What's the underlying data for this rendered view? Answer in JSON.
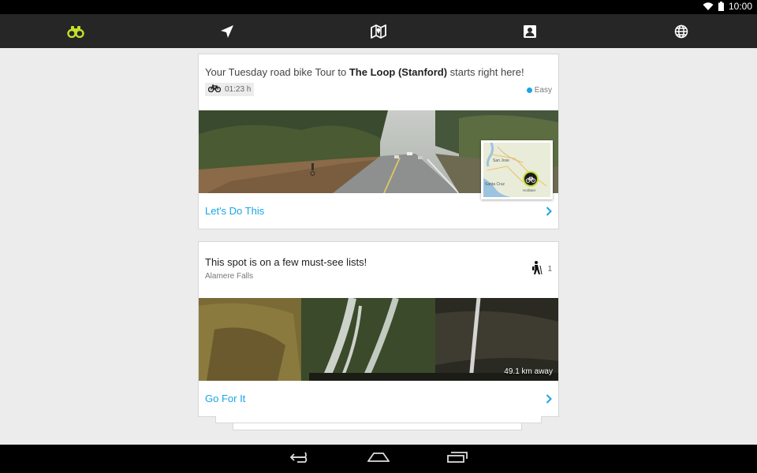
{
  "status_bar": {
    "time": "10:00"
  },
  "nav": {
    "tabs": [
      {
        "name": "discover",
        "icon": "binoculars-icon",
        "active": true
      },
      {
        "name": "navigate",
        "icon": "navigation-arrow-icon",
        "active": false
      },
      {
        "name": "map",
        "icon": "map-icon",
        "active": false
      },
      {
        "name": "profile",
        "icon": "contact-card-icon",
        "active": false
      },
      {
        "name": "explore",
        "icon": "globe-icon",
        "active": false
      }
    ],
    "active_color": "#c6e02c"
  },
  "cards": [
    {
      "intro": "Your Tuesday road bike Tour to ",
      "destination": "The Loop (Stanford)",
      "outro": " starts right here!",
      "duration": "01:23 h",
      "difficulty": "Easy",
      "difficulty_color": "#1aa4e6",
      "action": "Let's Do This",
      "map_labels": [
        "San Jose",
        "Santa Cruz",
        "Hollister"
      ]
    },
    {
      "title": "This spot is on a few must-see lists!",
      "subtitle": "Alamere Falls",
      "list_count": "1",
      "distance": "49.1 km away",
      "action": "Go For It"
    }
  ],
  "accent_color": "#1aa4e6"
}
